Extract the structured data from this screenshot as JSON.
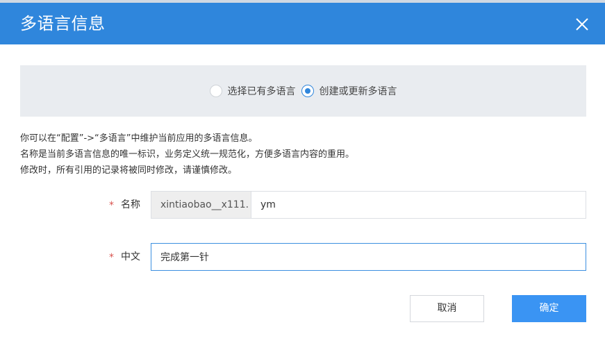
{
  "dialog": {
    "title": "多语言信息",
    "close_icon": "close-icon"
  },
  "mode": {
    "options": [
      {
        "label": "选择已有多语言",
        "checked": false
      },
      {
        "label": "创建或更新多语言",
        "checked": true
      }
    ]
  },
  "help": {
    "lines": [
      "你可以在“配置”->“多语言”中维护当前应用的多语言信息。",
      "名称是当前多语言信息的唯一标识，业务定义统一规范化，方便多语言内容的重用。",
      "修改时，所有引用的记录将被同时修改，请谨慎修改。"
    ]
  },
  "form": {
    "required_mark": "*",
    "name": {
      "label": "名称",
      "prefix": "xintiaobao__x111.",
      "value": "ym"
    },
    "chinese": {
      "label": "中文",
      "value": "完成第一针"
    }
  },
  "buttons": {
    "cancel": "取消",
    "ok": "确定"
  },
  "colors": {
    "header": "#2f86dc",
    "primary": "#3a94f3",
    "panel": "#e9ecf0",
    "required": "#d9534f"
  }
}
